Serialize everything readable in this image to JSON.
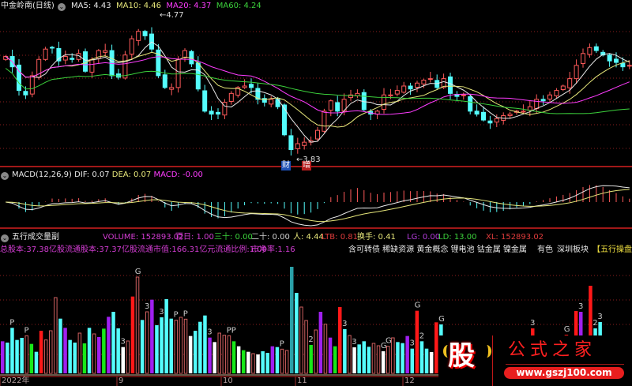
{
  "header": {
    "title": "中金岭南(日线)",
    "ma": [
      {
        "label": "MA5: 4.43",
        "color": "#e8e8e8"
      },
      {
        "label": "MA10: 4.46",
        "color": "#e6e67a"
      },
      {
        "label": "MA20: 4.37",
        "color": "#ff3cff"
      },
      {
        "label": "MA60: 4.24",
        "color": "#3cd23c"
      }
    ],
    "high_label": "4.77",
    "low_label": "3.83",
    "badge_cai": "财",
    "badge_zeng": "增"
  },
  "macd_header": {
    "name": "MACD(12,26,9)",
    "dif": "DIF: 0.07",
    "dea": "DEA: 0.07",
    "macd": "MACD: -0.00"
  },
  "volume_header": {
    "name": "五行成交量副",
    "items": [
      {
        "text": "VOLUME: 152893.02",
        "color": "#d23cd2"
      },
      {
        "text": "百日: 1.00",
        "color": "#d23cd2"
      },
      {
        "text": "三十: 0.00",
        "color": "#3cd23c"
      },
      {
        "text": "二十: 0.00",
        "color": "#d0d0d0"
      },
      {
        "text": "人: 4.44",
        "color": "#e6e67a"
      },
      {
        "text": "LTB: 0.81",
        "color": "#e03c3c"
      },
      {
        "text": "换手: 0.41",
        "color": "#e6e67a"
      },
      {
        "text": "LG: 0.00",
        "color": "#b43cdc"
      },
      {
        "text": "LD: 13.00",
        "color": "#3cd23c"
      },
      {
        "text": "XL: 152893.02",
        "color": "#e03c3c"
      }
    ],
    "info_left": "总股本:37.38亿股流通股本:37.37亿股流通市值:166.31亿元流通比例:1.00",
    "pb": "市净率:1.16",
    "concepts": "含可转债 稀缺资源 黄金概念 锂电池 钴金属 镍金属",
    "industry": "有色",
    "region": "深圳板块",
    "brand": "【五行操盘"
  },
  "x_axis": {
    "labels": [
      "2022年",
      "9",
      "10",
      "11",
      "12"
    ]
  },
  "colors": {
    "up": "#ff5a5a",
    "down": "#54fcfc",
    "grid": "#8c1e1e",
    "ma5": "#e8e8e8",
    "ma10": "#e6e67a",
    "ma20": "#ff3cff",
    "ma60": "#3cd23c"
  },
  "chart_data": [
    {
      "type": "candlestick",
      "title": "中金岭南(日线)",
      "ylim": [
        3.83,
        4.77
      ],
      "closes": [
        4.5,
        4.43,
        4.27,
        4.24,
        4.37,
        4.48,
        4.55,
        4.56,
        4.47,
        4.5,
        4.48,
        4.52,
        4.4,
        4.48,
        4.54,
        4.54,
        4.37,
        4.36,
        4.51,
        4.62,
        4.67,
        4.64,
        4.55,
        4.37,
        4.29,
        4.29,
        4.48,
        4.54,
        4.45,
        4.28,
        4.13,
        4.11,
        4.11,
        4.19,
        4.25,
        4.29,
        4.3,
        4.29,
        4.21,
        4.19,
        4.21,
        4.16,
        3.97,
        3.87,
        3.91,
        3.92,
        3.93,
        4.0,
        4.13,
        4.2,
        4.13,
        4.21,
        4.24,
        4.25,
        4.14,
        4.11,
        4.13,
        4.24,
        4.24,
        4.27,
        4.3,
        4.28,
        4.32,
        4.34,
        4.35,
        4.29,
        4.35,
        4.25,
        4.23,
        4.24,
        4.13,
        4.11,
        4.07,
        4.05,
        4.08,
        4.1,
        4.11,
        4.13,
        4.13,
        4.16,
        4.21,
        4.2,
        4.24,
        4.27,
        4.3,
        4.35,
        4.44,
        4.52,
        4.56,
        4.54,
        4.51,
        4.47,
        4.46,
        4.43,
        4.44
      ],
      "grid": true
    },
    {
      "type": "bar",
      "title": "五行成交量副",
      "bars": [
        [
          122,
          "purple"
        ],
        [
          117,
          "cyan"
        ],
        [
          173,
          "cyan"
        ],
        [
          127,
          "cyan"
        ],
        [
          135,
          "cyan"
        ],
        [
          143,
          "hollow"
        ],
        [
          112,
          "green"
        ],
        [
          82,
          "cyan"
        ],
        [
          162,
          "red"
        ],
        [
          127,
          "hollow"
        ],
        [
          162,
          "hollow"
        ],
        [
          288,
          "hollow"
        ],
        [
          208,
          "cyan"
        ],
        [
          173,
          "purple"
        ],
        [
          127,
          "cyan"
        ],
        [
          117,
          "cyan"
        ],
        [
          153,
          "hollow"
        ],
        [
          114,
          "green"
        ],
        [
          173,
          "cyan"
        ],
        [
          150,
          "hollow"
        ],
        [
          138,
          "purple"
        ],
        [
          170,
          "green"
        ],
        [
          215,
          "purple"
        ],
        [
          234,
          "cyan"
        ],
        [
          171,
          "cyan"
        ],
        [
          100,
          "white"
        ],
        [
          123,
          "hollow"
        ],
        [
          292,
          "red"
        ],
        [
          366,
          "hollow"
        ],
        [
          203,
          "cyan"
        ],
        [
          234,
          "hollow"
        ],
        [
          280,
          "purple"
        ],
        [
          183,
          "cyan"
        ],
        [
          213,
          "cyan"
        ],
        [
          282,
          "cyan"
        ],
        [
          208,
          "cyan"
        ],
        [
          202,
          "hollow"
        ],
        [
          213,
          "hollow"
        ],
        [
          206,
          "hollow"
        ],
        [
          142,
          "white"
        ],
        [
          162,
          "cyan"
        ],
        [
          196,
          "cyan"
        ],
        [
          220,
          "cyan"
        ],
        [
          136,
          "purple"
        ],
        [
          119,
          "white"
        ],
        [
          153,
          "hollow"
        ],
        [
          145,
          "hollow"
        ],
        [
          143,
          "hollow"
        ],
        [
          122,
          "green"
        ],
        [
          103,
          "white"
        ],
        [
          88,
          "green"
        ],
        [
          82,
          "white"
        ],
        [
          75,
          "hollow"
        ],
        [
          72,
          "white"
        ],
        [
          84,
          "cyan"
        ],
        [
          78,
          "cyan"
        ],
        [
          103,
          "purple"
        ],
        [
          100,
          "cyan"
        ],
        [
          92,
          "hollow"
        ],
        [
          87,
          "hollow"
        ],
        [
          405,
          "teal"
        ],
        [
          306,
          "cyan"
        ],
        [
          252,
          "hollow"
        ],
        [
          201,
          "hollow"
        ],
        [
          108,
          "green"
        ],
        [
          165,
          "hollow"
        ],
        [
          234,
          "purple"
        ],
        [
          187,
          "hollow"
        ],
        [
          136,
          "purple"
        ],
        [
          103,
          "green"
        ],
        [
          252,
          "red"
        ],
        [
          168,
          "cyan"
        ],
        [
          144,
          "hollow"
        ],
        [
          99,
          "white"
        ],
        [
          110,
          "cyan"
        ],
        [
          122,
          "cyan"
        ],
        [
          101,
          "cyan"
        ],
        [
          114,
          "hollow"
        ],
        [
          105,
          "hollow"
        ],
        [
          84,
          "white"
        ],
        [
          103,
          "hollow"
        ],
        [
          135,
          "hollow"
        ],
        [
          119,
          "cyan"
        ],
        [
          115,
          "cyan"
        ],
        [
          142,
          "purple"
        ],
        [
          94,
          "cyan"
        ],
        [
          238,
          "red"
        ],
        [
          122,
          "cyan"
        ],
        [
          94,
          "cyan"
        ],
        [
          81,
          "white"
        ],
        [
          194,
          "red"
        ],
        [
          186,
          "cyan"
        ],
        null,
        null,
        null,
        null,
        null,
        null,
        null,
        null,
        null,
        null,
        null,
        null,
        null,
        null,
        null,
        null,
        null,
        null,
        [
          171,
          "red"
        ],
        null,
        null,
        null,
        null,
        null,
        null,
        [
          147,
          "red"
        ],
        null,
        [
          237,
          "red"
        ],
        [
          234,
          "purple"
        ],
        null,
        [
          333,
          "red"
        ],
        [
          171,
          "cyan"
        ],
        [
          195,
          "cyan"
        ],
        null,
        null,
        null,
        null
      ],
      "annotations": [
        {
          "index": 2,
          "text": "P"
        },
        {
          "index": 5,
          "text": "P"
        },
        {
          "index": 25,
          "text": "3"
        },
        {
          "index": 28,
          "text": "G"
        },
        {
          "index": 30,
          "text": "3"
        },
        {
          "index": 33,
          "text": "3"
        },
        {
          "index": 36,
          "text": "P"
        },
        {
          "index": 38,
          "text": "P"
        },
        {
          "index": 43,
          "text": "3"
        },
        {
          "index": 47,
          "text": "PP"
        },
        {
          "index": 58,
          "text": "P"
        },
        {
          "index": 64,
          "text": "2"
        },
        {
          "index": 71,
          "text": "3"
        },
        {
          "index": 73,
          "text": "3"
        },
        {
          "index": 79,
          "text": "G"
        },
        {
          "index": 80,
          "text": "G"
        },
        {
          "index": 85,
          "text": "3"
        },
        {
          "index": 86,
          "text": "G"
        },
        {
          "index": 87,
          "text": "2"
        },
        {
          "index": 91,
          "text": "G"
        },
        {
          "index": 110,
          "text": "3"
        },
        {
          "index": 117,
          "text": "G"
        },
        {
          "index": 120,
          "text": "3"
        },
        {
          "index": 123,
          "text": "2"
        },
        {
          "index": 124,
          "text": "3"
        }
      ]
    }
  ],
  "watermark": {
    "logo": "股",
    "name": "公式之家",
    "url": "www.gszj100.com"
  }
}
